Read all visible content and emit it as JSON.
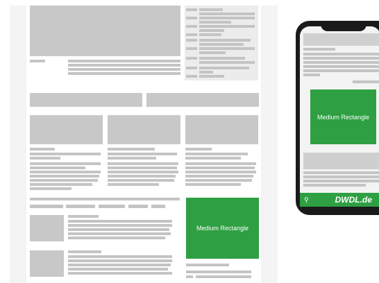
{
  "ads": {
    "desktop_label": "Medium Rectangle",
    "mobile_label": "Medium Rectangle"
  },
  "mobile": {
    "brand": "DWDL.de",
    "search_icon": "search-icon"
  },
  "colors": {
    "accent_green": "#2ea043",
    "placeholder_grey": "#c8c8c8",
    "page_background": "#f2f2f2"
  }
}
